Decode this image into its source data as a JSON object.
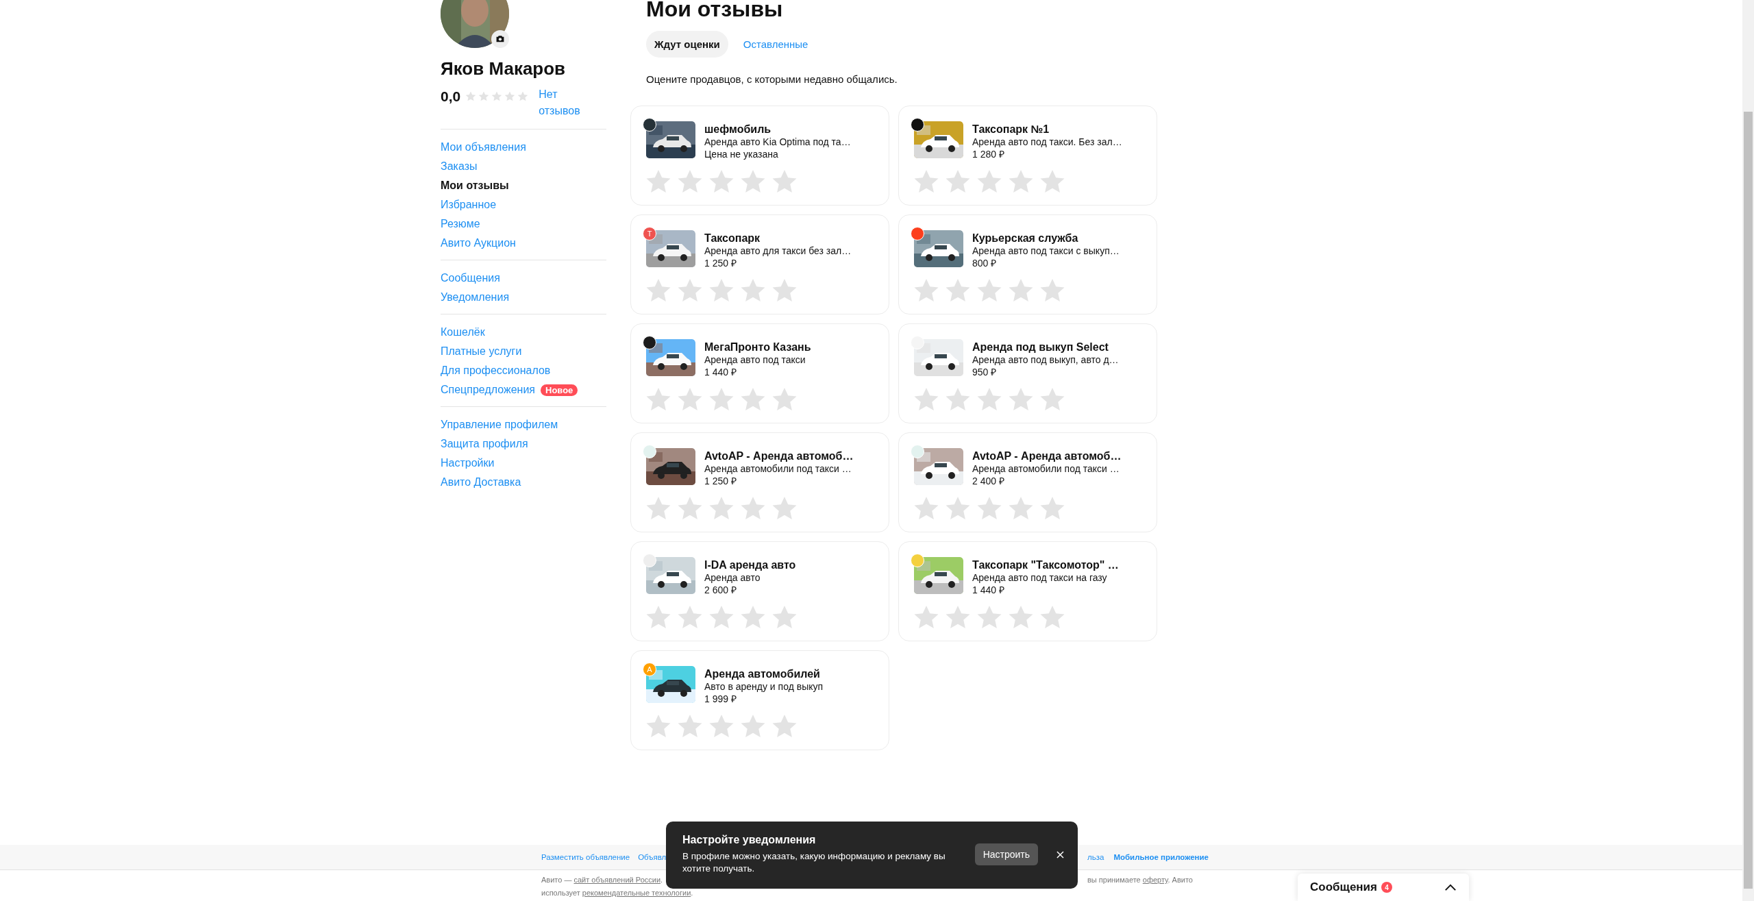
{
  "profile": {
    "name": "Яков Макаров",
    "rating": "0,0",
    "stars": 0,
    "reviews_link": "Нет отзывов"
  },
  "nav_groups": [
    {
      "items": [
        {
          "label": "Мои объявления",
          "selected": false
        },
        {
          "label": "Заказы",
          "selected": false
        },
        {
          "label": "Мои отзывы",
          "selected": true
        },
        {
          "label": "Избранное",
          "selected": false
        },
        {
          "label": "Резюме",
          "selected": false
        },
        {
          "label": "Авито Аукцион",
          "selected": false
        }
      ]
    },
    {
      "items": [
        {
          "label": "Сообщения",
          "selected": false
        },
        {
          "label": "Уведомления",
          "selected": false
        }
      ]
    },
    {
      "items": [
        {
          "label": "Кошелёк",
          "selected": false
        },
        {
          "label": "Платные услуги",
          "selected": false
        },
        {
          "label": "Для профессионалов",
          "selected": false
        },
        {
          "label": "Спецпредложения",
          "selected": false,
          "badge": "Новое"
        }
      ]
    },
    {
      "items": [
        {
          "label": "Управление профилем",
          "selected": false
        },
        {
          "label": "Защита профиля",
          "selected": false
        },
        {
          "label": "Настройки",
          "selected": false
        },
        {
          "label": "Авито Доставка",
          "selected": false
        }
      ]
    }
  ],
  "page_title": "Мои отзывы",
  "tabs": [
    {
      "label": "Ждут оценки",
      "selected": true
    },
    {
      "label": "Оставленные",
      "selected": false
    }
  ],
  "description": "Оцените продавцов, с которыми недавно общались.",
  "cards": [
    {
      "title": "шефмобиль",
      "subtitle": "Аренда авто Kia Optima под та…",
      "price": "Цена не указана",
      "color": "#263238",
      "stars": 0
    },
    {
      "title": "Таксопарк №1",
      "subtitle": "Аренда авто под такси. Без зал…",
      "price": "1 280 ₽",
      "color": "#111111",
      "stars": 0
    },
    {
      "title": "Таксопарк",
      "subtitle": "Аренда авто для такси без зал…",
      "price": "1 250 ₽",
      "color": "#ef5350",
      "badge_letter": "Т",
      "stars": 0
    },
    {
      "title": "Курьерская служба",
      "subtitle": "Аренда авто под такси с выкуп…",
      "price": "800 ₽",
      "color": "#fc3f1d",
      "stars": 0
    },
    {
      "title": "МегаПронто Казань",
      "subtitle": "Аренда авто под такси",
      "price": "1 440 ₽",
      "color": "#1c1c1c",
      "stars": 0
    },
    {
      "title": "Аренда под выкуп Select",
      "subtitle": "Аренда авто под выкуп, авто д…",
      "price": "950 ₽",
      "color": "#f5f5f5",
      "stars": 0
    },
    {
      "title": "AvtoAP - Аренда автомоб…",
      "subtitle": "Аренда автомобили под такси …",
      "price": "1 250 ₽",
      "color": "#e3f2ef",
      "stars": 0
    },
    {
      "title": "AvtoAP - Аренда автомоб…",
      "subtitle": "Аренда автомобили под такси …",
      "price": "2 400 ₽",
      "color": "#e3f2ef",
      "stars": 0
    },
    {
      "title": "I-DA аренда авто",
      "subtitle": "Аренда авто",
      "price": "2 600 ₽",
      "color": "#eeeeee",
      "stars": 0
    },
    {
      "title": "Таксопарк \"Таксомотор\" …",
      "subtitle": "Аренда авто под такси на газу",
      "price": "1 440 ₽",
      "color": "#f4d03f",
      "stars": 0
    },
    {
      "title": "Аренда автомобилей",
      "subtitle": "Авто в аренду и под выкуп",
      "price": "1 999 ₽",
      "color": "#ffa000",
      "badge_letter": "А",
      "stars": 0
    }
  ],
  "footer": {
    "links_left": [
      {
        "text": "Разместить объявление",
        "emphasized": false
      },
      {
        "text": "Объявл",
        "emphasized": false
      }
    ],
    "links_right": [
      {
        "text": "льза",
        "emphasized": false
      },
      {
        "text": "Мобильное приложение",
        "emphasized": true
      }
    ],
    "legal_left": {
      "before": "Авито — ",
      "link": "сайт объявлений России",
      "after": "."
    },
    "legal_right": {
      "before": "вы принимаете ",
      "link": "оферту",
      "after": ". Авито"
    },
    "legal_line2": {
      "before": "использует ",
      "link": "рекомендательные технологии",
      "after": "."
    }
  },
  "toast": {
    "title": "Настройте уведомления",
    "text": "В профиле можно указать, какую информацию и рекламу вы хотите получать.",
    "button": "Настроить"
  },
  "messages_widget": {
    "label": "Сообщения",
    "count": "4"
  }
}
